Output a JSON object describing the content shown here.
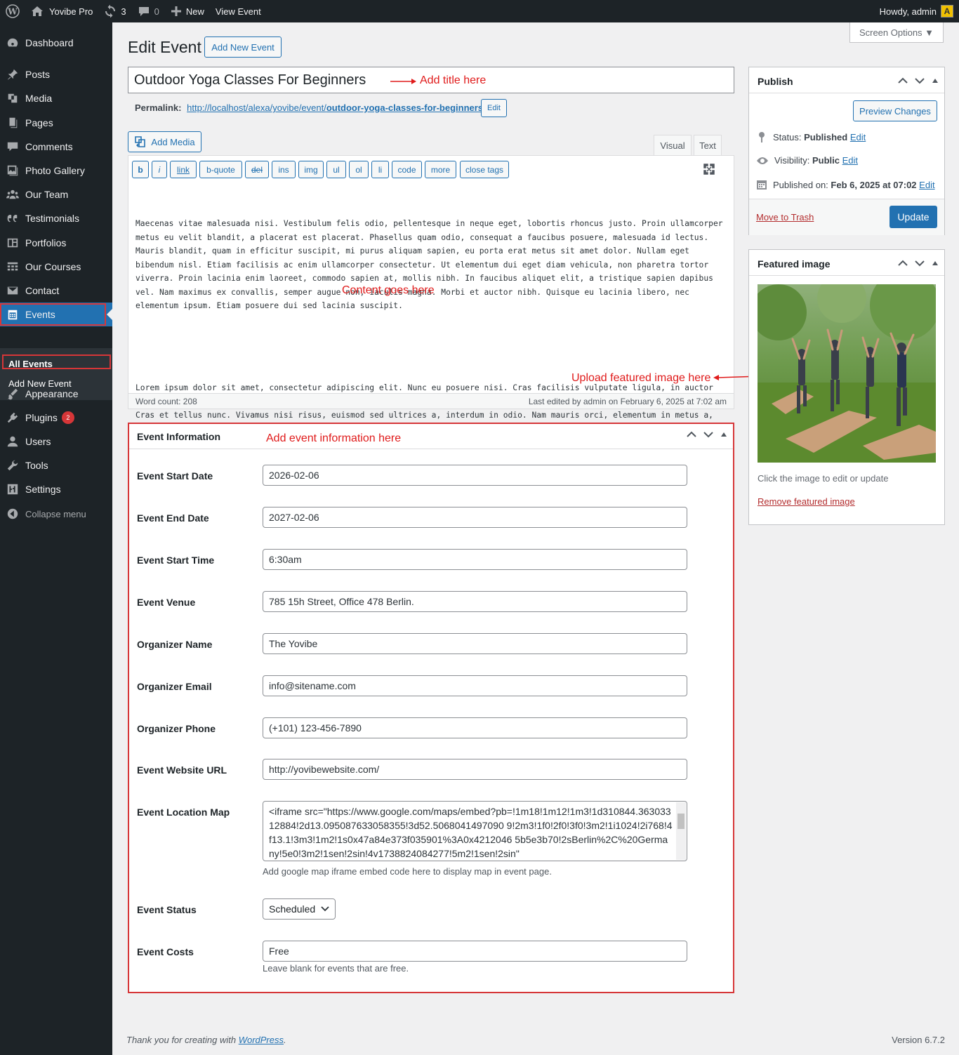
{
  "adminbar": {
    "site_name": "Yovibe Pro",
    "updates_count": "3",
    "comments_count": "0",
    "new_label": "New",
    "view_label": "View Event",
    "howdy": "Howdy, admin",
    "avatar_letter": "A"
  },
  "sidebar": {
    "items": {
      "dashboard": "Dashboard",
      "posts": "Posts",
      "media": "Media",
      "pages": "Pages",
      "comments": "Comments",
      "photo_gallery": "Photo Gallery",
      "our_team": "Our Team",
      "testimonials": "Testimonials",
      "portfolios": "Portfolios",
      "our_courses": "Our Courses",
      "contact": "Contact",
      "events": "Events",
      "appearance": "Appearance",
      "plugins": "Plugins",
      "users": "Users",
      "tools": "Tools",
      "settings": "Settings",
      "collapse": "Collapse menu"
    },
    "plugins_badge": "2",
    "events_sub": {
      "all_events": "All Events",
      "add_new_event": "Add New Event"
    }
  },
  "screen_options": "Screen Options ▼",
  "page": {
    "title": "Edit Event",
    "add_new_button": "Add New Event",
    "post_title": "Outdoor Yoga Classes For Beginners",
    "permalink_label": "Permalink:",
    "permalink_base": "http://localhost/alexa/yovibe/event/",
    "permalink_slug": "outdoor-yoga-classes-for-beginners",
    "permalink_end": "/",
    "permalink_edit": "Edit"
  },
  "annotations": {
    "title": "Add title here",
    "content": "Content goes here",
    "featured": "Upload featured image here",
    "event_info": "Add event information here"
  },
  "editor": {
    "add_media": "Add Media",
    "tab_visual": "Visual",
    "tab_text": "Text",
    "buttons": [
      "b",
      "i",
      "link",
      "b-quote",
      "del",
      "ins",
      "img",
      "ul",
      "ol",
      "li",
      "code",
      "more",
      "close tags"
    ],
    "paragraph1": "Maecenas vitae malesuada nisi. Vestibulum felis odio, pellentesque in neque eget, lobortis rhoncus justo. Proin ullamcorper metus eu velit blandit, a placerat est placerat. Phasellus quam odio, consequat a faucibus posuere, malesuada id lectus. Mauris blandit, quam in efficitur suscipit, mi purus aliquam sapien, eu porta erat metus sit amet dolor. Nullam eget bibendum nisl. Etiam facilisis ac enim ullamcorper consectetur. Ut elementum dui eget diam vehicula, non pharetra tortor viverra. Proin lacinia enim laoreet, commodo sapien at, mollis nibh. In faucibus aliquet elit, a tristique sapien dapibus vel. Nam maximus ex convallis, semper augue non, iaculis magna. Morbi et auctor nibh. Quisque eu lacinia libero, nec elementum ipsum. Etiam posuere dui sed lacinia suscipit.",
    "paragraph2": "Lorem ipsum dolor sit amet, consectetur adipiscing elit. Nunc eu posuere nisi. Cras facilisis vulputate ligula, in auctor neque euismod id. In hac habitasse platea dictumst. Nullam erat dui, tempor at tellus in, sollicitudin hendrerit sapien. Cras et tellus nunc. Vivamus nisi risus, euismod sed ultrices a, interdum in odio. Nam mauris orci, elementum in metus a, pharetra erat. Suspendisse lacinia diam non interdum ultrices. Nam tristique velit id ligula congue, a placerat justo varius. Aliquam cursus dignissim feugiat. Suspendisse ante leo, ultrices eu lacus eget, rhoncus suscipit ligula. Aliquam erat volutpat.",
    "word_count": "Word count: 208",
    "last_edited": "Last edited by admin on February 6, 2025 at 7:02 am"
  },
  "event_info": {
    "title": "Event Information",
    "fields": {
      "start_date_label": "Event Start Date",
      "start_date": "2026-02-06",
      "end_date_label": "Event End Date",
      "end_date": "2027-02-06",
      "start_time_label": "Event Start Time",
      "start_time": "6:30am",
      "venue_label": "Event Venue",
      "venue": "785 15h Street, Office 478 Berlin.",
      "org_name_label": "Organizer Name",
      "org_name": "The Yovibe",
      "org_email_label": "Organizer Email",
      "org_email": "info@sitename.com",
      "org_phone_label": "Organizer Phone",
      "org_phone": "(+101) 123-456-7890",
      "website_label": "Event Website URL",
      "website": "http://yovibewebsite.com/",
      "map_label": "Event Location Map",
      "map": "<iframe src=\"https://www.google.com/maps/embed?pb=!1m18!1m12!1m3!1d310844.36303312884!2d13.095087633058355!3d52.5068041497090 9!2m3!1f0!2f0!3f0!3m2!1i1024!2i768!4f13.1!3m3!1m2!1s0x47a84e373f035901%3A0x4212046 5b5e3b70!2sBerlin%2C%20Germany!5e0!3m2!1sen!2sin!4v1738824084277!5m2!1sen!2sin\"",
      "map_desc": "Add google map iframe embed code here to display map in event page.",
      "status_label": "Event Status",
      "status": "Scheduled",
      "costs_label": "Event Costs",
      "costs": "Free",
      "costs_desc": "Leave blank for events that are free."
    }
  },
  "publish": {
    "title": "Publish",
    "preview": "Preview Changes",
    "status_label": "Status:",
    "status_value": "Published",
    "visibility_label": "Visibility:",
    "visibility_value": "Public",
    "published_label": "Published on:",
    "published_value": "Feb 6, 2025 at 07:02",
    "edit": "Edit",
    "trash": "Move to Trash",
    "update": "Update"
  },
  "featured": {
    "title": "Featured image",
    "hint": "Click the image to edit or update",
    "remove": "Remove featured image"
  },
  "footer": {
    "thanks": "Thank you for creating with",
    "wp_link": "WordPress",
    "period": ".",
    "version": "Version 6.7.2"
  }
}
